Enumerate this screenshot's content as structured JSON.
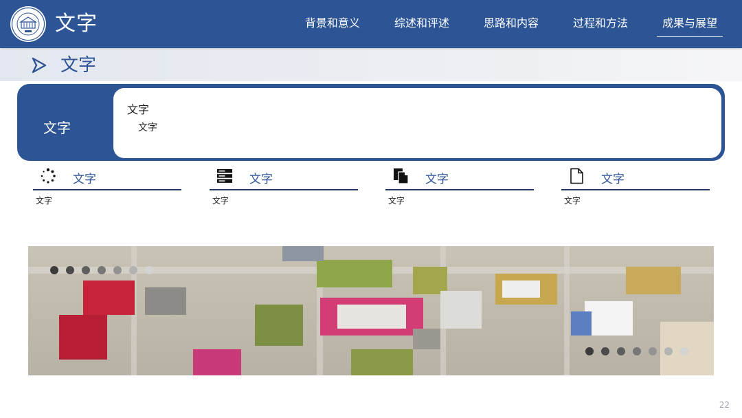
{
  "header": {
    "title": "文字",
    "nav": [
      {
        "label": "背景和意义"
      },
      {
        "label": "综述和评述"
      },
      {
        "label": "思路和内容"
      },
      {
        "label": "过程和方法"
      },
      {
        "label": "成果与展望",
        "active": true
      }
    ]
  },
  "section": {
    "title": "文字"
  },
  "callout": {
    "label": "文字",
    "line1": "文字",
    "line2": "文字"
  },
  "features": [
    {
      "icon": "loading-spinner-icon",
      "title": "文字",
      "desc": "文字"
    },
    {
      "icon": "server-stack-icon",
      "title": "文字",
      "desc": "文字"
    },
    {
      "icon": "copy-documents-icon",
      "title": "文字",
      "desc": "文字"
    },
    {
      "icon": "document-icon",
      "title": "文字",
      "desc": "文字"
    }
  ],
  "banner": {
    "image": "aerial-campus-photo"
  },
  "footer": {
    "page_number": "22"
  },
  "colors": {
    "primary": "#2d5596",
    "dark_rule": "#1f3864",
    "band": "#e9ecf2"
  }
}
